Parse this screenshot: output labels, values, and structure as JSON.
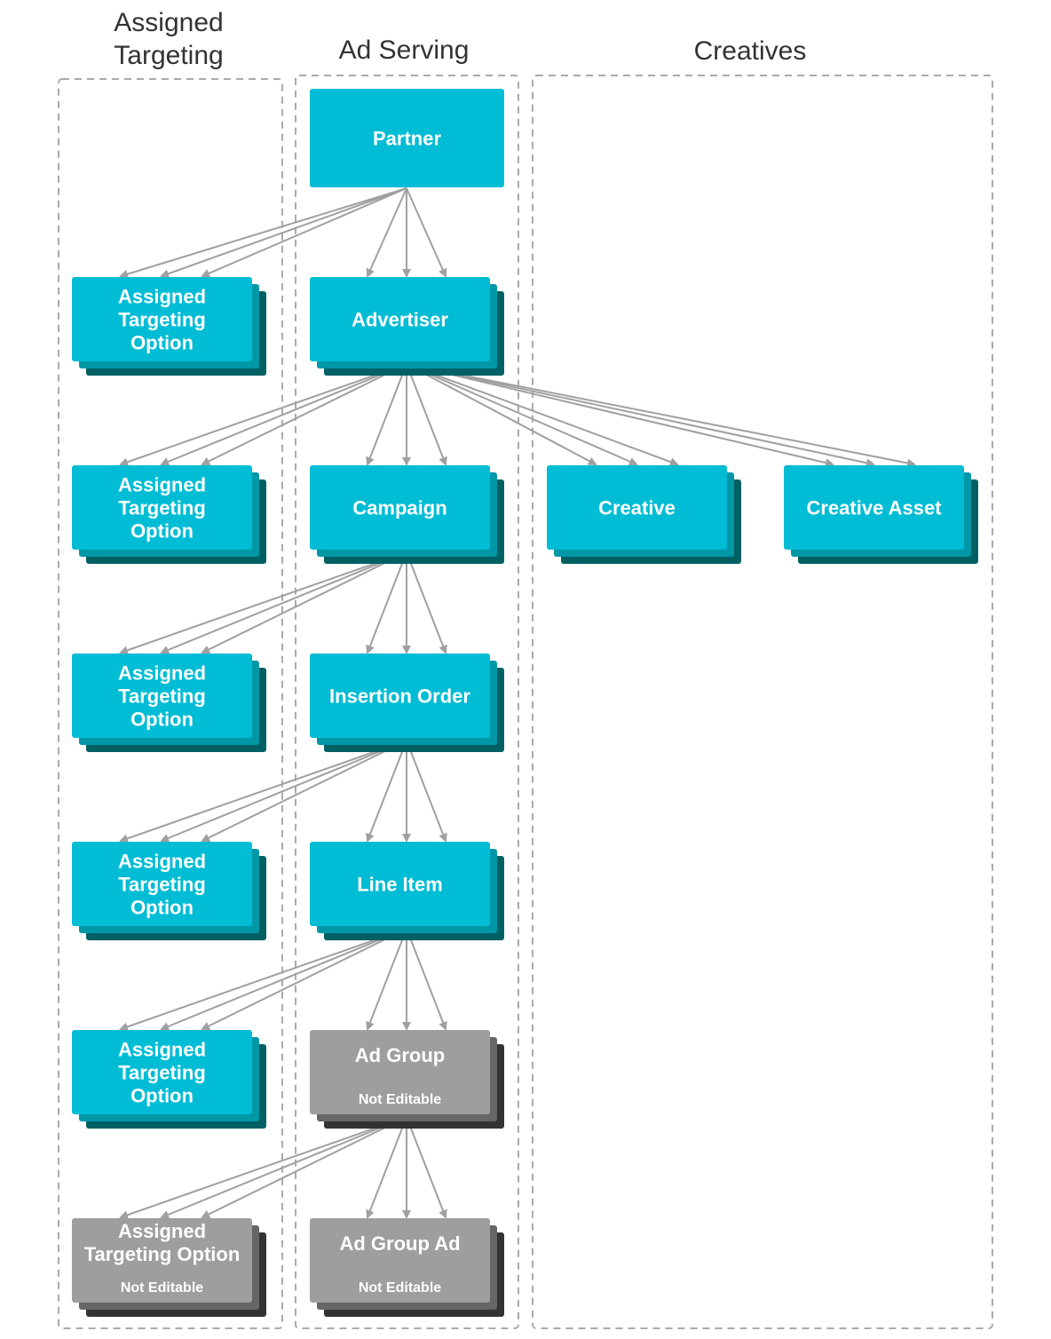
{
  "groups": [
    {
      "id": "assigned",
      "title_lines": [
        "Assigned",
        "Targeting"
      ]
    },
    {
      "id": "adserving",
      "title_lines": [
        "Ad Serving"
      ]
    },
    {
      "id": "creatives",
      "title_lines": [
        "Creatives"
      ]
    }
  ],
  "colors": {
    "editable": [
      "#00BCD4",
      "#0097A7",
      "#006064"
    ],
    "not_editable": [
      "#9E9E9E",
      "#666666",
      "#333333"
    ],
    "arrow": "#A0A0A0",
    "group_border": "#AAAAAA"
  },
  "nodes": [
    {
      "id": "partner",
      "lines": [
        "Partner"
      ],
      "editable": true,
      "multiple": false
    },
    {
      "id": "advertiser",
      "lines": [
        "Advertiser"
      ],
      "editable": true,
      "multiple": true
    },
    {
      "id": "campaign",
      "lines": [
        "Campaign"
      ],
      "editable": true,
      "multiple": true
    },
    {
      "id": "insertion_order",
      "lines": [
        "Insertion Order"
      ],
      "editable": true,
      "multiple": true
    },
    {
      "id": "line_item",
      "lines": [
        "Line Item"
      ],
      "editable": true,
      "multiple": true
    },
    {
      "id": "ad_group",
      "lines": [
        "Ad Group"
      ],
      "sub": "Not Editable",
      "editable": false,
      "multiple": true
    },
    {
      "id": "ad_group_ad",
      "lines": [
        "Ad Group Ad"
      ],
      "sub": "Not Editable",
      "editable": false,
      "multiple": true
    },
    {
      "id": "ato1",
      "lines": [
        "Assigned",
        "Targeting",
        "Option"
      ],
      "editable": true,
      "multiple": true
    },
    {
      "id": "ato2",
      "lines": [
        "Assigned",
        "Targeting",
        "Option"
      ],
      "editable": true,
      "multiple": true
    },
    {
      "id": "ato3",
      "lines": [
        "Assigned",
        "Targeting",
        "Option"
      ],
      "editable": true,
      "multiple": true
    },
    {
      "id": "ato4",
      "lines": [
        "Assigned",
        "Targeting",
        "Option"
      ],
      "editable": true,
      "multiple": true
    },
    {
      "id": "ato5",
      "lines": [
        "Assigned",
        "Targeting",
        "Option"
      ],
      "editable": true,
      "multiple": true
    },
    {
      "id": "ato6",
      "lines": [
        "Assigned",
        "Targeting Option"
      ],
      "sub": "Not Editable",
      "editable": false,
      "multiple": true
    },
    {
      "id": "creative",
      "lines": [
        "Creative"
      ],
      "editable": true,
      "multiple": true
    },
    {
      "id": "creative_asset",
      "lines": [
        "Creative Asset"
      ],
      "editable": true,
      "multiple": true
    }
  ],
  "edges": [
    {
      "from": "partner",
      "to": "advertiser",
      "cardinality": "many"
    },
    {
      "from": "partner",
      "to": "ato1",
      "cardinality": "many"
    },
    {
      "from": "advertiser",
      "to": "campaign",
      "cardinality": "many"
    },
    {
      "from": "advertiser",
      "to": "ato2",
      "cardinality": "many"
    },
    {
      "from": "advertiser",
      "to": "creative",
      "cardinality": "many"
    },
    {
      "from": "advertiser",
      "to": "creative_asset",
      "cardinality": "many"
    },
    {
      "from": "campaign",
      "to": "insertion_order",
      "cardinality": "many"
    },
    {
      "from": "campaign",
      "to": "ato3",
      "cardinality": "many"
    },
    {
      "from": "insertion_order",
      "to": "line_item",
      "cardinality": "many"
    },
    {
      "from": "insertion_order",
      "to": "ato4",
      "cardinality": "many"
    },
    {
      "from": "line_item",
      "to": "ad_group",
      "cardinality": "many"
    },
    {
      "from": "line_item",
      "to": "ato5",
      "cardinality": "many"
    },
    {
      "from": "ad_group",
      "to": "ad_group_ad",
      "cardinality": "many"
    },
    {
      "from": "ad_group",
      "to": "ato6",
      "cardinality": "many"
    }
  ]
}
